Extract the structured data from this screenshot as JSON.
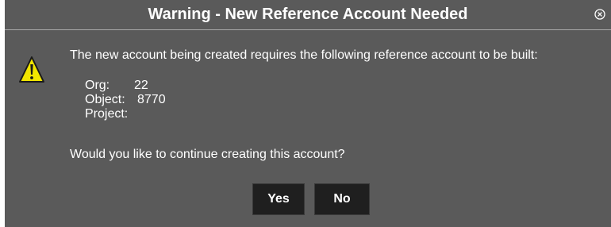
{
  "dialog": {
    "title": "Warning - New Reference Account Needed",
    "close_icon": "circle-x-icon",
    "warning_icon": "warning-triangle-icon",
    "message": "The new account being created requires the following reference account to be built:",
    "details": [
      {
        "label": "Org:",
        "value": "22"
      },
      {
        "label": "Object:",
        "value": "8770"
      },
      {
        "label": "Project:",
        "value": ""
      }
    ],
    "question": "Would you like to continue creating this account?",
    "buttons": {
      "yes_label": "Yes",
      "no_label": "No"
    }
  },
  "colors": {
    "dialog_background": "#5a5a5a",
    "button_background": "#1f1f1f",
    "text": "#ffffff",
    "warning_fill": "#f2e600"
  }
}
